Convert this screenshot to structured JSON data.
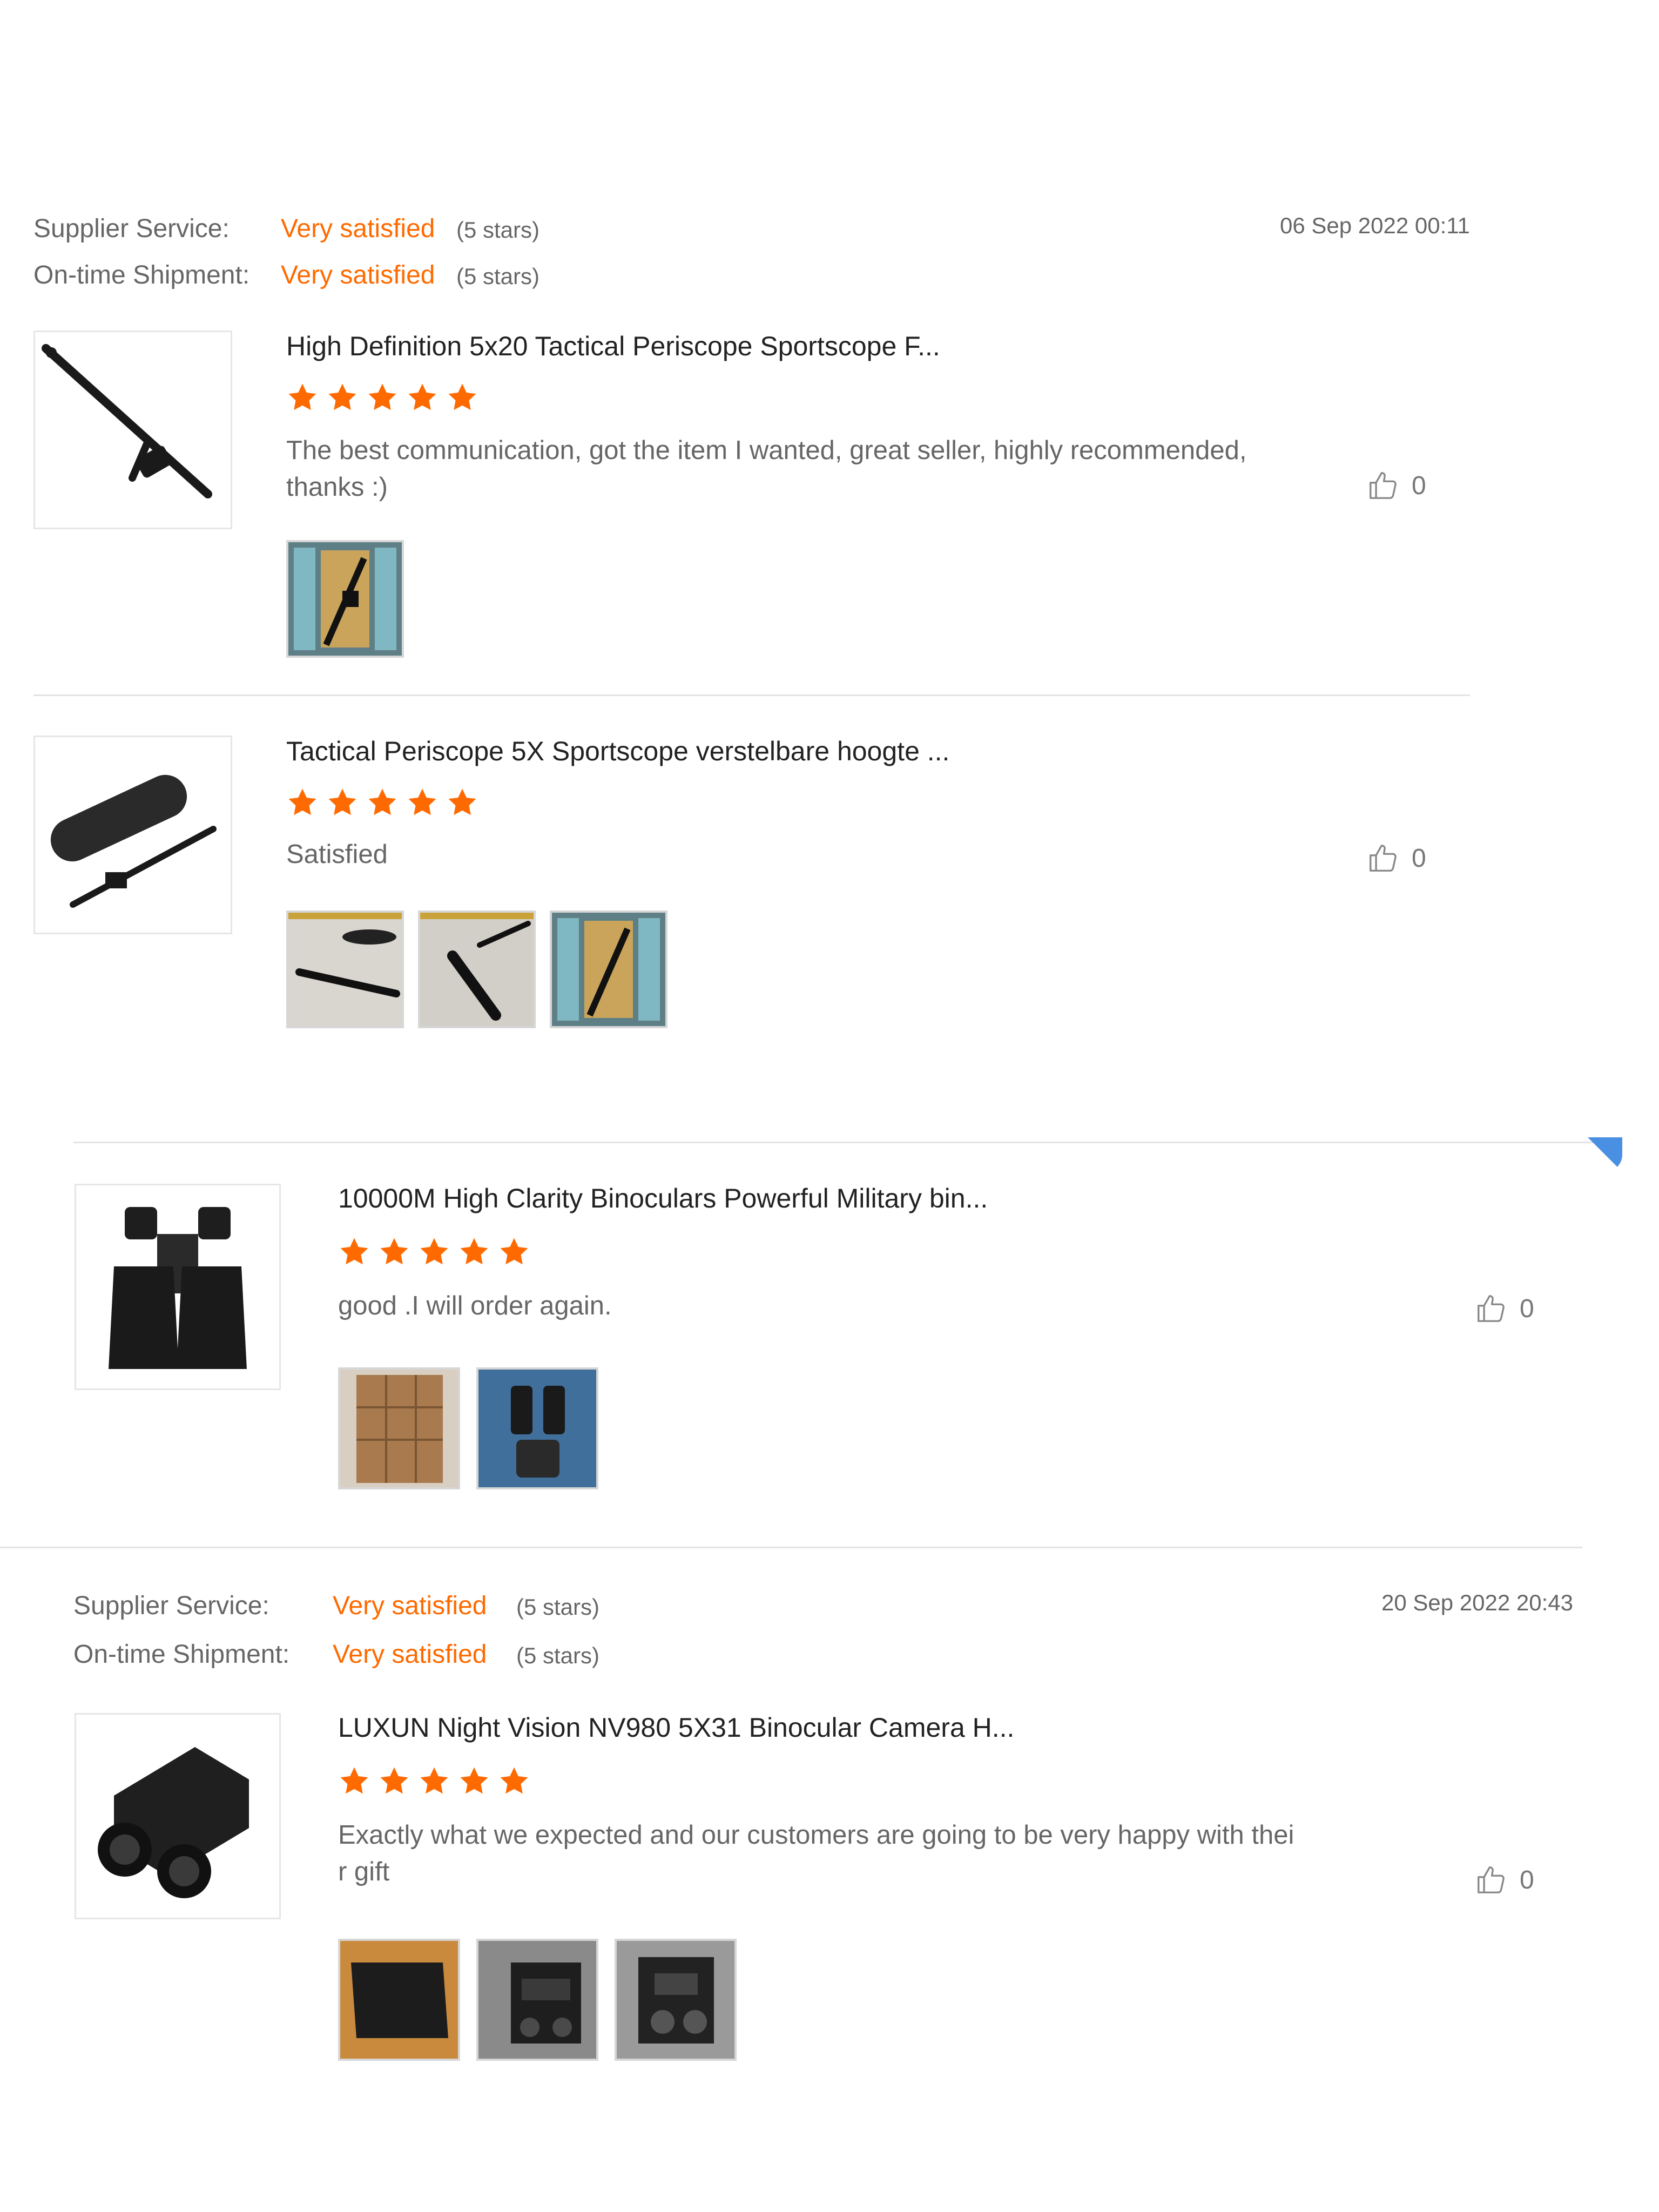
{
  "colors": {
    "accent": "#ff6a00",
    "label": "#666666",
    "title": "#222222",
    "divider": "#e3e3e3",
    "scroll_indicator": "#4a90e2"
  },
  "icons": {
    "star": "star-icon",
    "like": "thumbs-up-icon"
  },
  "reviews": [
    {
      "supplier_label": "Supplier Service:",
      "supplier_value": "Very satisfied",
      "supplier_stars": "(5 stars)",
      "shipment_label": "On-time Shipment:",
      "shipment_value": "Very satisfied",
      "shipment_stars": "(5 stars)",
      "date": "06 Sep 2022 00:11",
      "items": [
        {
          "product_title": "High Definition 5x20 Tactical Periscope Sportscope F...",
          "rating": 5,
          "text": "The best communication, got the item I wanted, great seller, highly recommended, thanks :)",
          "likes": "0",
          "photo_count": 1
        },
        {
          "product_title": "Tactical Periscope 5X Sportscope verstelbare hoogte ...",
          "rating": 5,
          "text": "Satisfied",
          "likes": "0",
          "photo_count": 3
        }
      ]
    },
    {
      "items": [
        {
          "product_title": "10000M High Clarity Binoculars Powerful Military bin...",
          "rating": 5,
          "text": "good .I will order again.",
          "likes": "0",
          "photo_count": 2
        }
      ]
    },
    {
      "supplier_label": "Supplier Service:",
      "supplier_value": "Very satisfied",
      "supplier_stars": "(5 stars)",
      "shipment_label": "On-time Shipment:",
      "shipment_value": "Very satisfied",
      "shipment_stars": "(5 stars)",
      "date": "20 Sep 2022 20:43",
      "items": [
        {
          "product_title": "LUXUN Night Vision NV980 5X31 Binocular Camera H...",
          "rating": 5,
          "text_line1": "Exactly what we expected and our customers are going to be very happy with thei",
          "text_line2": "r gift",
          "likes": "0",
          "photo_count": 3
        }
      ]
    }
  ]
}
